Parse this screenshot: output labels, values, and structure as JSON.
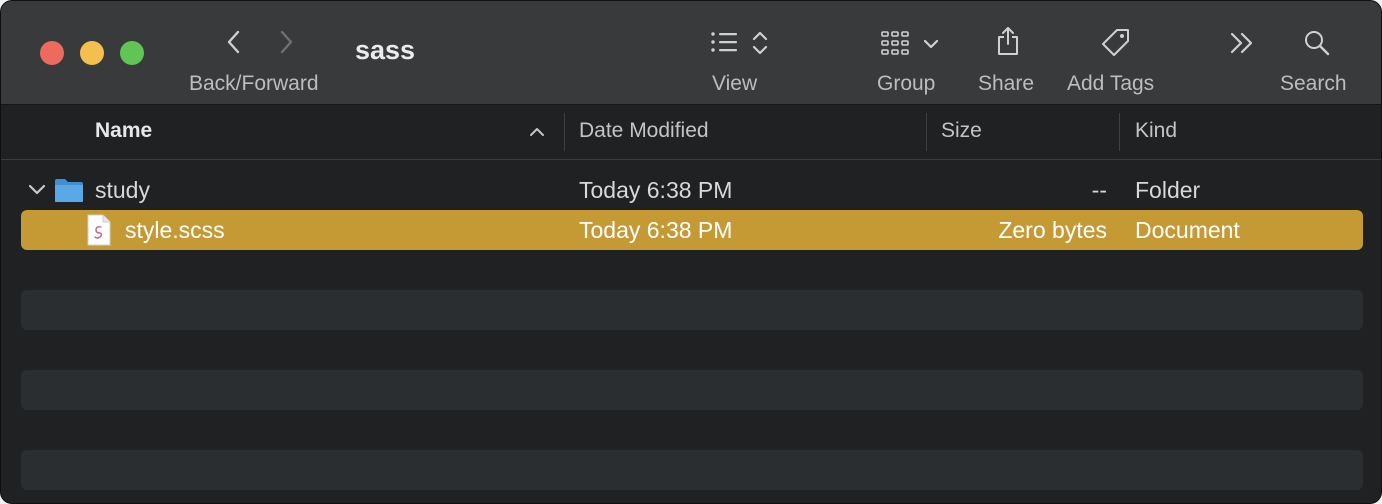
{
  "window": {
    "title": "sass"
  },
  "toolbar": {
    "back_forward_label": "Back/Forward",
    "view_label": "View",
    "group_label": "Group",
    "share_label": "Share",
    "add_tags_label": "Add Tags",
    "search_label": "Search",
    "icons": [
      "chevron-left-icon",
      "chevron-right-icon",
      "list-view-icon",
      "updown-chevron-icon",
      "grid-group-icon",
      "chevron-down-icon",
      "share-icon",
      "tag-icon",
      "double-chevron-right-icon",
      "magnifier-icon"
    ]
  },
  "columns": {
    "name": "Name",
    "date_modified": "Date Modified",
    "size": "Size",
    "kind": "Kind"
  },
  "rows": [
    {
      "name": "study",
      "date": "Today 6:38 PM",
      "size": "--",
      "kind": "Folder",
      "icon": "folder-icon",
      "expanded": true
    },
    {
      "name": "style.scss",
      "date": "Today 6:38 PM",
      "size": "Zero bytes",
      "kind": "Document",
      "icon": "document-icon",
      "selected": true
    }
  ],
  "colors": {
    "selection": "#c59a34",
    "close": "#ed6a5e",
    "minimize": "#f5bf4f",
    "maximize": "#61c554",
    "folder": "#5aa9e6"
  }
}
